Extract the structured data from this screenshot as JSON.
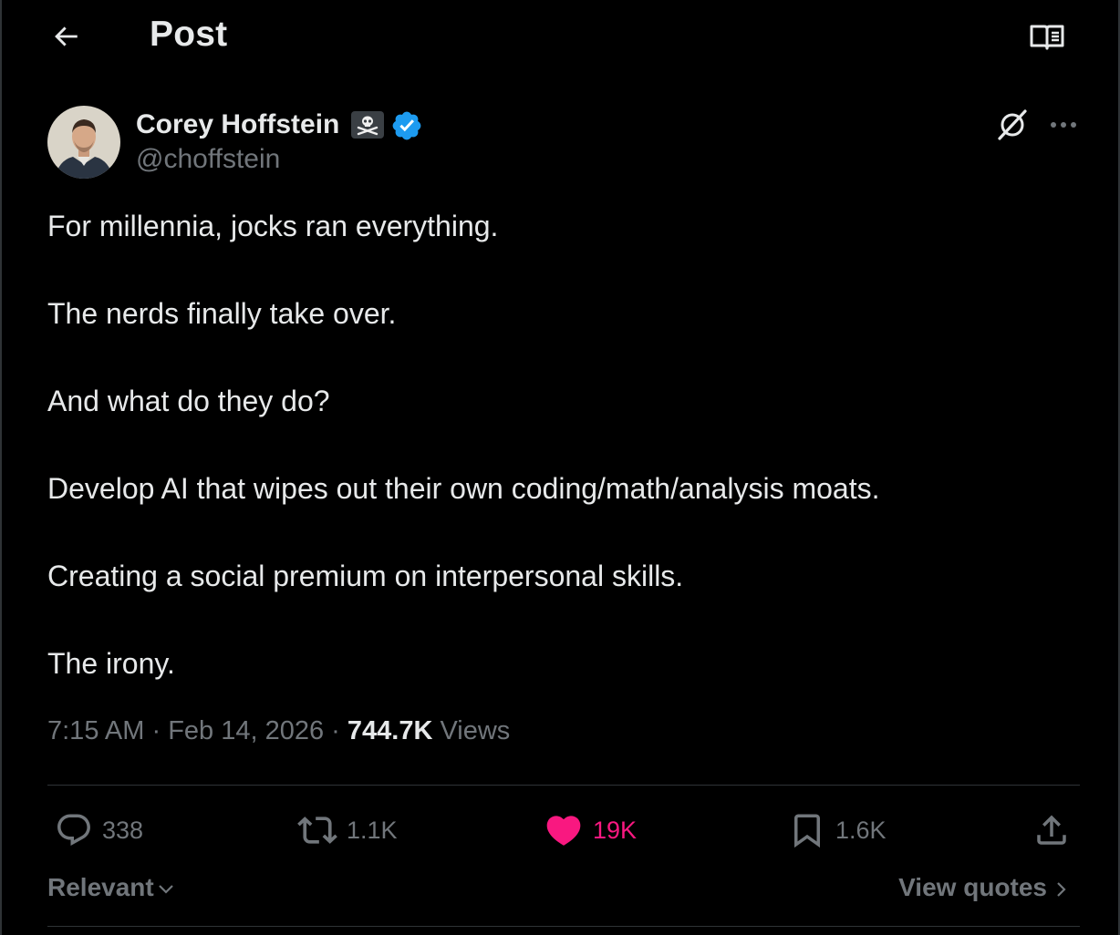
{
  "header": {
    "title": "Post",
    "back_icon": "arrow-left-icon",
    "reader_icon": "reader-book-icon"
  },
  "author": {
    "name": "Corey Hoffstein",
    "handle": "@choffstein",
    "affiliation_icon": "skull-crossbones-icon",
    "verified": true,
    "verified_color": "#1d9bf0"
  },
  "tweet": {
    "lines": [
      "For millennia, jocks ran everything.",
      "The nerds finally take over.",
      "And what do they do?",
      "Develop AI that wipes out their own coding/math/analysis moats.",
      "Creating a social premium on interpersonal skills.",
      "The irony."
    ]
  },
  "meta": {
    "time": "7:15 AM",
    "separator": " · ",
    "date": "Feb 14, 2026",
    "views_count": "744.7K",
    "views_label": "Views"
  },
  "actions": {
    "replies": "338",
    "reposts": "1.1K",
    "likes": "19K",
    "bookmarks": "1.6K",
    "like_color": "#f91880"
  },
  "footer": {
    "sort_label": "Relevant",
    "view_quotes_label": "View quotes"
  },
  "colors": {
    "background": "#000000",
    "text": "#e7e9ea",
    "muted": "#71767b",
    "border": "#2f3336"
  }
}
